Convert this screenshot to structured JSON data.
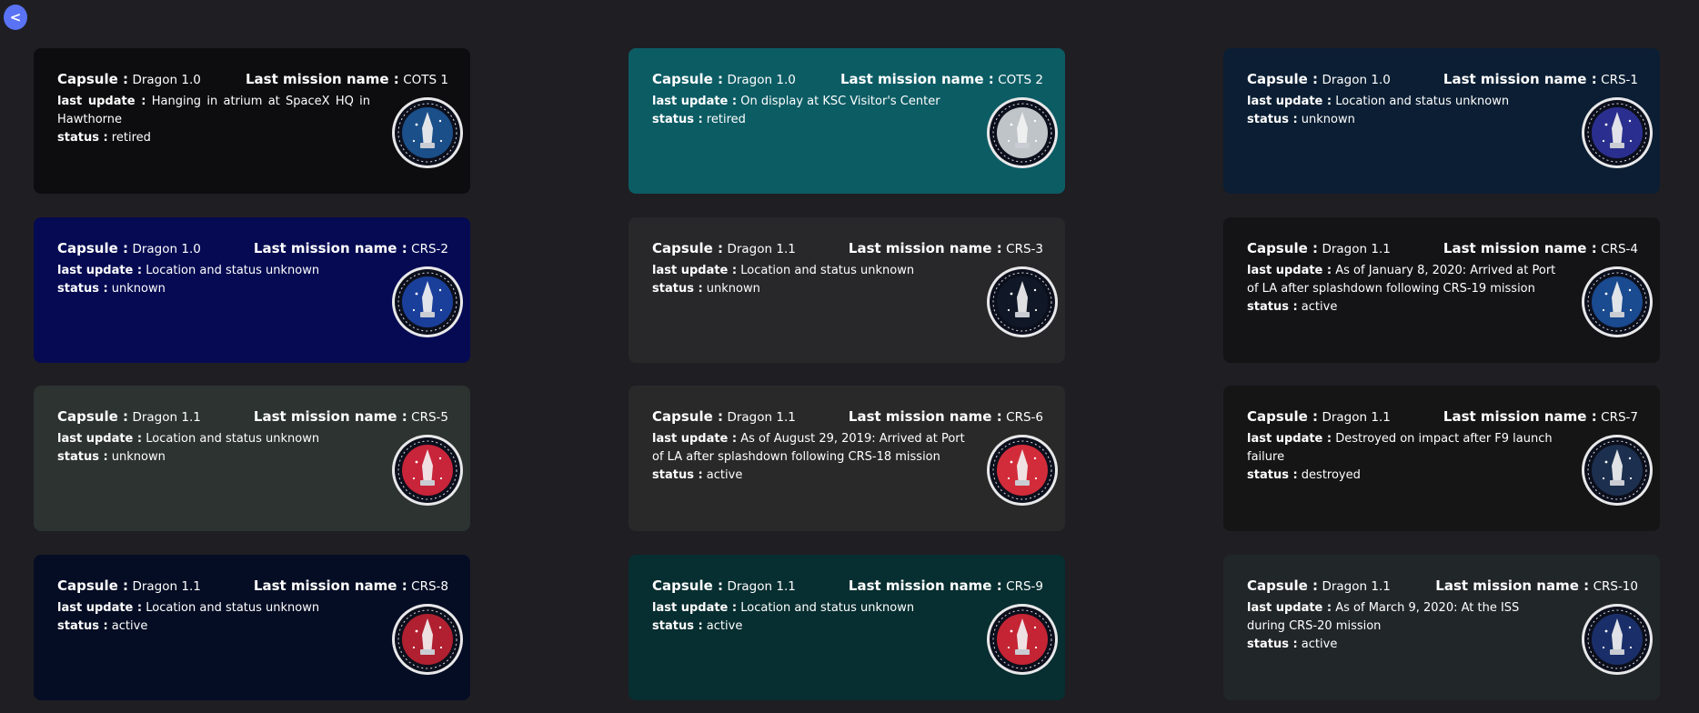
{
  "nav": {
    "back_label": "<"
  },
  "labels": {
    "capsule": "Capsule :",
    "last_mission": "Last mission name :",
    "last_update": "last update :",
    "status": "status :"
  },
  "cards": [
    {
      "capsule": "Dragon 1.0",
      "mission": "COTS 1",
      "update": "Hanging in atrium at SpaceX HQ in Hawthorne",
      "status": "retired",
      "bg": "#0d0d0f",
      "badge": "cots1-mission-patch-icon",
      "patch_color": "#1a4f8a"
    },
    {
      "capsule": "Dragon 1.0",
      "mission": "COTS 2",
      "update": "On display at KSC Visitor's Center",
      "status": "retired",
      "bg": "#0c5c64",
      "badge": "cots2-mission-patch-icon",
      "patch_color": "#bfc4c8"
    },
    {
      "capsule": "Dragon 1.0",
      "mission": "CRS-1",
      "update": "Location and status unknown",
      "status": "unknown",
      "bg": "#0b1e33",
      "badge": "crs1-mission-patch-icon",
      "patch_color": "#2a2f8f"
    },
    {
      "capsule": "Dragon 1.0",
      "mission": "CRS-2",
      "update": "Location and status unknown",
      "status": "unknown",
      "bg": "#050a52",
      "badge": "crs2-mission-patch-icon",
      "patch_color": "#1a3f9a"
    },
    {
      "capsule": "Dragon 1.1",
      "mission": "CRS-3",
      "update": "Location and status unknown",
      "status": "unknown",
      "bg": "#28282a",
      "badge": "crs3-mission-patch-icon",
      "patch_color": "#101828"
    },
    {
      "capsule": "Dragon 1.1",
      "mission": "CRS-4",
      "update": "As of January 8, 2020: Arrived at Port of LA after splashdown following CRS-19 mission",
      "status": "active",
      "bg": "#141416",
      "badge": "crs4-mission-patch-icon",
      "patch_color": "#1a4a8f"
    },
    {
      "capsule": "Dragon 1.1",
      "mission": "CRS-5",
      "update": "Location and status unknown",
      "status": "unknown",
      "bg": "#2c3330",
      "badge": "crs5-mission-patch-icon",
      "patch_color": "#c8243a"
    },
    {
      "capsule": "Dragon 1.1",
      "mission": "CRS-6",
      "update": "As of August 29, 2019: Arrived at Port of LA after splashdown following CRS-18 mission",
      "status": "active",
      "bg": "#292929",
      "badge": "crs6-mission-patch-icon",
      "patch_color": "#d22c3a"
    },
    {
      "capsule": "Dragon 1.1",
      "mission": "CRS-7",
      "update": "Destroyed on impact after F9 launch failure",
      "status": "destroyed",
      "bg": "#151515",
      "badge": "crs7-mission-patch-icon",
      "patch_color": "#1c2f4f"
    },
    {
      "capsule": "Dragon 1.1",
      "mission": "CRS-8",
      "update": "Location and status unknown",
      "status": "active",
      "bg": "#050d24",
      "badge": "crs8-mission-patch-icon",
      "patch_color": "#b02030"
    },
    {
      "capsule": "Dragon 1.1",
      "mission": "CRS-9",
      "update": "Location and status unknown",
      "status": "active",
      "bg": "#072e30",
      "badge": "crs9-mission-patch-icon",
      "patch_color": "#c42434"
    },
    {
      "capsule": "Dragon 1.1",
      "mission": "CRS-10",
      "update": "As of March 9, 2020: At the ISS during CRS-20 mission",
      "status": "active",
      "bg": "#212628",
      "badge": "crs10-mission-patch-icon",
      "patch_color": "#1a2f6a"
    }
  ]
}
